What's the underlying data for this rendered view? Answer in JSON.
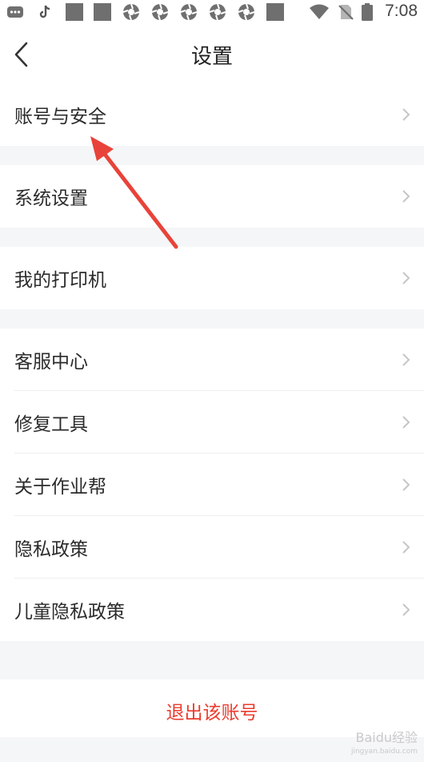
{
  "status_bar": {
    "time": "7:08",
    "icons": [
      "chat-icon",
      "tiktok-icon",
      "app-icon",
      "app-icon",
      "aperture-icon",
      "aperture-icon",
      "aperture-icon",
      "aperture-icon",
      "aperture-icon",
      "app-icon",
      "wifi-icon",
      "no-sim-icon",
      "battery-icon"
    ]
  },
  "header": {
    "title": "设置"
  },
  "groups": [
    {
      "items": [
        {
          "label": "账号与安全"
        }
      ]
    },
    {
      "items": [
        {
          "label": "系统设置"
        }
      ]
    },
    {
      "items": [
        {
          "label": "我的打印机"
        }
      ]
    },
    {
      "items": [
        {
          "label": "客服中心"
        },
        {
          "label": "修复工具"
        },
        {
          "label": "关于作业帮"
        },
        {
          "label": "隐私政策"
        },
        {
          "label": "儿童隐私政策"
        }
      ]
    }
  ],
  "logout": {
    "label": "退出该账号"
  },
  "annotation": {
    "color": "#e8433a"
  },
  "watermark": {
    "text": "Baidu经验",
    "sub": "jingyan.baidu.com"
  }
}
